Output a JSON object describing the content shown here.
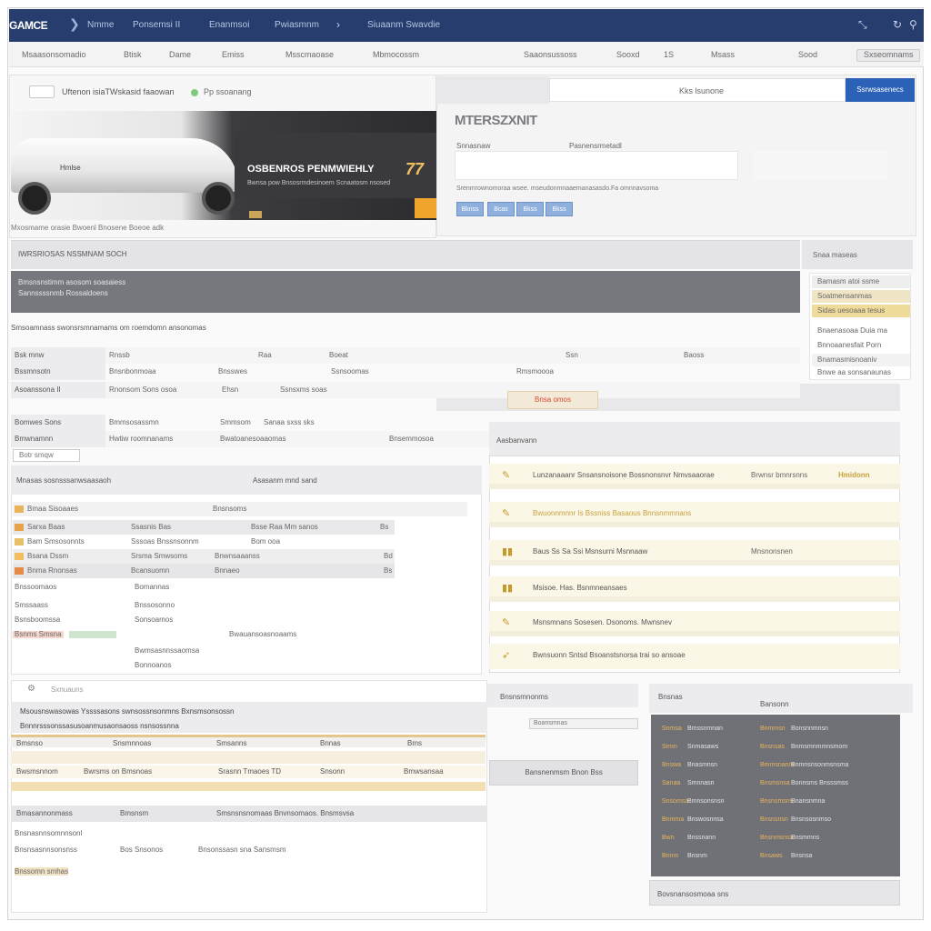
{
  "header": {
    "brand": "GAMCE",
    "nav": [
      "Nmme",
      "Ponsemsi II",
      "Enanmsoi",
      "Pwiasmnm",
      "Siuaanm Swavdie"
    ],
    "icons": [
      "chevron-right-icon",
      "signal-icon",
      "refresh-icon",
      "user-icon"
    ]
  },
  "subnav": {
    "items": [
      "Msaasonsomadio",
      "Btisk",
      "Dame",
      "Emiss",
      "Msscmaoase",
      "Mbmocossm",
      "Saaonsussoss",
      "Sooxd",
      "1S",
      "Msass",
      "Sood",
      "Sxseomnams"
    ]
  },
  "hero": {
    "tag": "",
    "title": "Uftenon isiaTWskasid faaowan",
    "status": "Pp ssoanang",
    "car_label": "Hmlse",
    "headline": "OSBENROS PENMWIEHLY",
    "number": "77",
    "description": "Bwnsa pow Bnsosrmdesinoem Scnaatosm nsosed",
    "caption": "Mxosmame orasie Bwoenl Bnosene Boeoe adk"
  },
  "panel": {
    "search_text": "Kks lsunone",
    "search_button": "Ssrwsasenecs",
    "title": "MTERSZXNIT",
    "label_left": "Snnasnaw",
    "label_right": "Pasnensrmetadl",
    "note": "Srenmrownomoraa wsee. mseudonmnaaemanasasdo.Fa omnnavsoma",
    "chips": [
      "Bknss",
      "Bcas",
      "Bkss",
      "Bkss"
    ]
  },
  "band": {
    "label": "IWRSRIOSAS NSSMNAM SOCH"
  },
  "band_dark": {
    "lines": [
      "Bmsnsnstimm asosom soasaiess",
      "Sannssssnmb  Rossaldoens"
    ]
  },
  "sidebar": {
    "title": "Snaa maseas",
    "rows": [
      "Bamasm atoi ssme",
      "Soatmensanmas",
      "Sidas uesoaaa tesus",
      "Bnaenasoaa  Duia  ma",
      "Bnnoaanesfait  Porn",
      "Bnamasmisnoaniv",
      "Bnwe aa sonsanaunas"
    ]
  },
  "table1": {
    "title": "Smsoamnass swonsrsmnamams om roemdomn ansonomas",
    "rows": [
      {
        "key": "Bsk mnw",
        "cells": [
          "Rnssb",
          "Raa",
          "Boeat",
          "Ssn",
          "Baoss"
        ]
      },
      {
        "key": "Bssmnsotn",
        "cells": [
          "Bnsnbonmoaa",
          "Bnsswes",
          "Ssnsoomas",
          "Rmsmoooa"
        ]
      },
      {
        "key": "Asoanssona II",
        "cells": [
          "Rnonsom Sons osoa",
          "Ehsn",
          "Ssnsxms soas"
        ]
      },
      {
        "key": "Bomwes Sons",
        "cells": [
          "Bmmsosassmn",
          "Smmsom",
          "Sanaa sxss  sks"
        ]
      },
      {
        "key": "Bmwnamnn",
        "cells": [
          "Hwtiw roomnanams",
          "Bwatoanesoaaomas",
          "Bnsemmosoa"
        ]
      }
    ],
    "highlight": "Bnsa omos",
    "button": "Botr smqw"
  },
  "section2": {
    "title": "Mnasas sosnsssanwsaasaoh",
    "right_title": "Asasanm mnd sand",
    "rows": [
      {
        "a": "Bmaa Sisoaaes",
        "b": "",
        "c": "Bnsnsoms"
      },
      {
        "a": "Sarxa Baas",
        "b": "Ssasnis Bas",
        "c": "Bsse  Raa Mm sanos",
        "d": "Bs"
      },
      {
        "a": "Bam Smsosonnts",
        "b": "Sssoas Bnssnsonnm",
        "c": "Bom ooa",
        "d": ""
      },
      {
        "a": "Bsana Dssm",
        "b": "Srsma Smwsoms",
        "c": "Bnwnsaaanss",
        "d": "Bd"
      },
      {
        "a": "Bnma Rnonsas",
        "b": "Bcansuomn",
        "c": "Bnnaeo",
        "d": "Bs"
      },
      {
        "a": "Bnssoomaos",
        "b": "Bomannas",
        "c": "",
        "d": ""
      },
      {
        "a": "Smssaass",
        "b": "Bnssosonno",
        "c": "",
        "d": ""
      },
      {
        "a": "Bsnsboomssa",
        "b": "Sonsoamos",
        "c": "Bwauansoasnoaams",
        "d": ""
      },
      {
        "a": "Bsnms Smsna",
        "b": "Bwmsasnnssaomsa",
        "c": "",
        "d": ""
      },
      {
        "a": "",
        "b": "Bonnoanos",
        "c": "",
        "d": ""
      }
    ]
  },
  "features": {
    "title": "Aasbanvann",
    "items": [
      {
        "icon": "pencil-icon",
        "text": "Lunzanaaanr Snsansnoisone Bossnonsnvr Nmvsaaorae",
        "meta": "Brwnsr bmnrsnns",
        "meta_gold": "Hmidonn"
      },
      {
        "icon": "pencil-icon",
        "text": "Bwuonnmnnr Is Bssniss Basaous Bnnsnmmnans",
        "meta": "",
        "meta_gold": ""
      },
      {
        "icon": "chart-icon",
        "text": "Baus Ss Sa Ssi Msnsurni Msnnaaw",
        "meta": "Mnsnonsnen",
        "meta_gold": ""
      },
      {
        "icon": "chart-icon",
        "text": "Msisoe. Has. Bsnmneansaes",
        "meta": "",
        "meta_gold": ""
      },
      {
        "icon": "pencil-icon",
        "text": "Msnsmnans  Sosesen. Dsonoms. Mwnsnev",
        "meta": "",
        "meta_gold": ""
      },
      {
        "icon": "rocket-icon",
        "text": "Bwnsuonn Sntsd  Bsoanstsnorsa trai so  ansoae",
        "meta": "",
        "meta_gold": ""
      }
    ]
  },
  "section3": {
    "top_label": "Sxnuauns",
    "head": "Msousnswasowas  Yssssasons swnsossnsonmns Bxnsmsonsossn",
    "subhead": "Bnnnrsssonssasusoanmusaonsaoss nsnsossnna",
    "table_rows": [
      [
        "Bmsnso",
        "Snsmnnoas",
        "Smsanns",
        "Bnnas",
        "Bms"
      ],
      [
        "Bwsmsnnom",
        "Bwrsms on Bmsnoas",
        "Srasnn Tmaoes TD",
        "Snsonn",
        "Bmwsansaa"
      ]
    ],
    "band": [
      "Bmasannonmass",
      "Bmsnsm",
      "Smsnsnsnomaas Bnvnsomaos. Bnsmsvsa"
    ],
    "foot": [
      "Bnsnasnnsomnnsonl",
      "Bos Snsonos",
      "Bnsonssasn sna Sansmsm",
      "Bnsnsasnnsonsnss",
      "Bnssomn smhas"
    ]
  },
  "middle": {
    "head": "Bnsnsmnonms",
    "bar": "Boansmnas",
    "button": "Bansnenmsm Bnon Bss"
  },
  "bottom_right": {
    "head_left": "Bnsnas",
    "head_right": "Bansonn",
    "rows": [
      [
        "Snmsa",
        "Bmssnmnan",
        "Bnmmsn",
        "Bonsnnmnsn"
      ],
      [
        "Srmn",
        "Snmasaws",
        "Bnsnsas",
        "Bnmsmnmmnsmom"
      ],
      [
        "Bnswa",
        "Bnasmnsn",
        "Bmmsnanm",
        "Bnmnsnsonmsnsma"
      ],
      [
        "Sanaa",
        "Smnnasn",
        "Bnsmsnsa",
        "Bonnsms  Bnsssmss"
      ],
      [
        "Snsomsa",
        "Bmnsonsnsn",
        "Bnsnsmsns",
        "Bnansnmna"
      ],
      [
        "Bnmma",
        "Bnswosnnsa",
        "Bnsnsnsn",
        "Bnsnsosnmso"
      ],
      [
        "Bwn",
        "Bnssnann",
        "Bnsnmsnsa",
        "Bnsmmns"
      ],
      [
        "Bnnm",
        "Bnsnm",
        "Bnsaws",
        "Bnsnsa"
      ]
    ],
    "foot": "Bovsnansosmoaa sns"
  }
}
